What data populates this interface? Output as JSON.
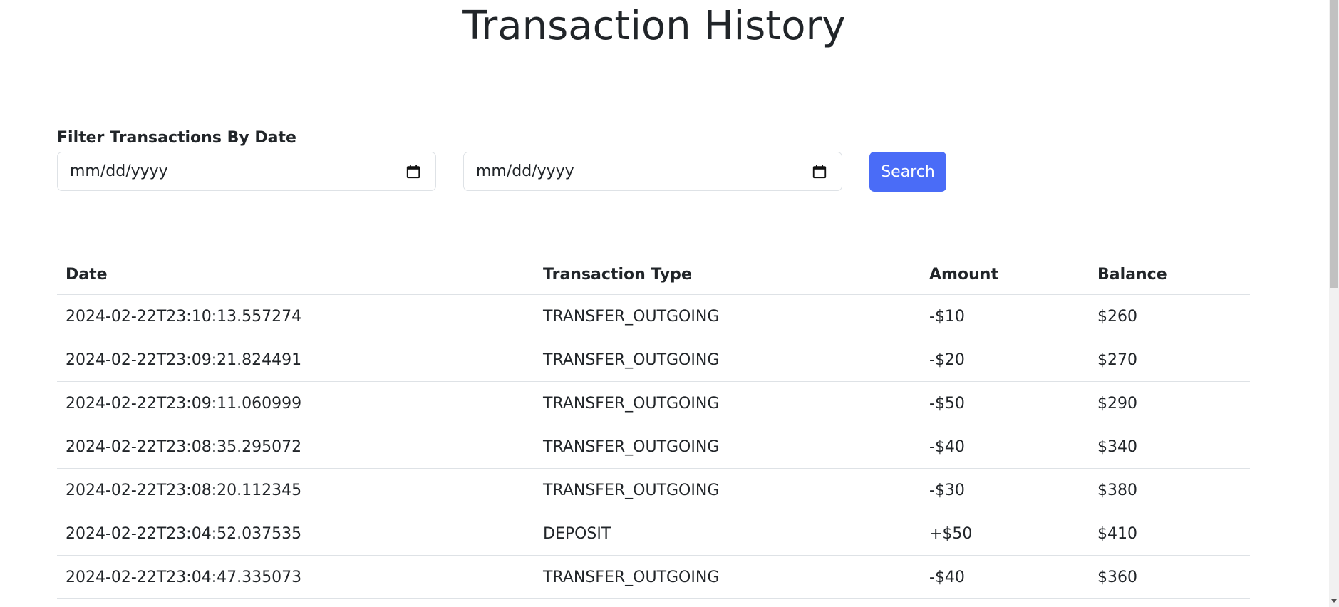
{
  "page": {
    "title": "Transaction History"
  },
  "filter": {
    "label": "Filter Transactions By Date",
    "from_placeholder": "mm/dd/yyyy",
    "to_placeholder": "mm/dd/yyyy",
    "search_label": "Search",
    "icon": "calendar-icon"
  },
  "table": {
    "headers": [
      "Date",
      "Transaction Type",
      "Amount",
      "Balance"
    ],
    "rows": [
      {
        "date": "2024-02-22T23:10:13.557274",
        "type": "TRANSFER_OUTGOING",
        "amount": "-$10",
        "balance": "$260"
      },
      {
        "date": "2024-02-22T23:09:21.824491",
        "type": "TRANSFER_OUTGOING",
        "amount": "-$20",
        "balance": "$270"
      },
      {
        "date": "2024-02-22T23:09:11.060999",
        "type": "TRANSFER_OUTGOING",
        "amount": "-$50",
        "balance": "$290"
      },
      {
        "date": "2024-02-22T23:08:35.295072",
        "type": "TRANSFER_OUTGOING",
        "amount": "-$40",
        "balance": "$340"
      },
      {
        "date": "2024-02-22T23:08:20.112345",
        "type": "TRANSFER_OUTGOING",
        "amount": "-$30",
        "balance": "$380"
      },
      {
        "date": "2024-02-22T23:04:52.037535",
        "type": "DEPOSIT",
        "amount": "+$50",
        "balance": "$410"
      },
      {
        "date": "2024-02-22T23:04:47.335073",
        "type": "TRANSFER_OUTGOING",
        "amount": "-$40",
        "balance": "$360"
      }
    ]
  },
  "colors": {
    "accent": "#4a6cf7",
    "text": "#212529",
    "border": "#dee2e6"
  }
}
